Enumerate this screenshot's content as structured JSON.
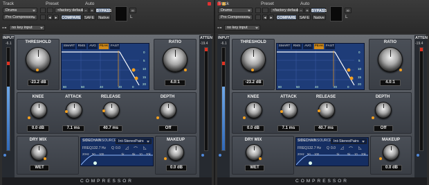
{
  "window_left": {
    "track_label": "Track",
    "preset_label": "Preset",
    "auto_label": "Auto",
    "track_name": "Drums",
    "plugin_name": "Pro Compressor",
    "preset_value": "<factory default>",
    "bypass": "BYPASS",
    "compare": "COMPARE",
    "safe": "SAFE",
    "native": "Native",
    "key_input": "no key input",
    "key_letter": "a",
    "channel_letter": "L"
  },
  "window_right": {
    "track_label": "Track",
    "preset_label": "Preset",
    "auto_label": "Auto",
    "track_name": "Drums",
    "plugin_name": "Pro Compressor",
    "preset_value": "<factory default>",
    "bypass": "BYPASS",
    "compare": "COMPARE",
    "safe": "SAFE",
    "native": "Native",
    "key_input": "no key input",
    "key_letter": "a",
    "channel_letter": "L"
  },
  "plugin": {
    "input_label": "INPUT",
    "input_peak": "-6.1",
    "atten_label": "ATTEN",
    "atten_peak": "-19.4",
    "threshold_label": "THRESHOLD",
    "threshold_value": "-23.2 dB",
    "ratio_label": "RATIO",
    "ratio_value": "4.0:1",
    "graph_tabs": [
      "SMART",
      "RMS",
      "AVG",
      "PEAK",
      "FAST"
    ],
    "graph_x_ticks": [
      "80",
      "60",
      "40",
      "20",
      "0"
    ],
    "graph_y_ticks": [
      "0",
      "5",
      "10",
      "15",
      "20"
    ],
    "knee_label": "KNEE",
    "knee_value": "0.0 dB",
    "attack_label": "ATTACK",
    "attack_value": "7.1 ms",
    "release_label": "RELEASE",
    "release_value": "40.7 ms",
    "depth_label": "DEPTH",
    "depth_value": "Off",
    "drymix_label": "DRY MIX",
    "drymix_value": "WET",
    "sidechain_label": "SIDECHAIN",
    "source_label": "SOURCE:",
    "source_value": "Int-StereoPairs",
    "freq_label": "FREQ",
    "freq_value": "132.7 Hz",
    "q_label": "Q",
    "q_value": "0.0",
    "freq_ticks": [
      "20Hz",
      "50",
      "100",
      "1k",
      "5k",
      "10",
      "20k"
    ],
    "makeup_label": "MAKEUP",
    "makeup_value": "0.0 dB",
    "brand": "COMPRESSOR"
  },
  "colors": {
    "accent": "#f4a020",
    "graph_bg": "#1e3c78",
    "meter": "#3f7fd0"
  }
}
